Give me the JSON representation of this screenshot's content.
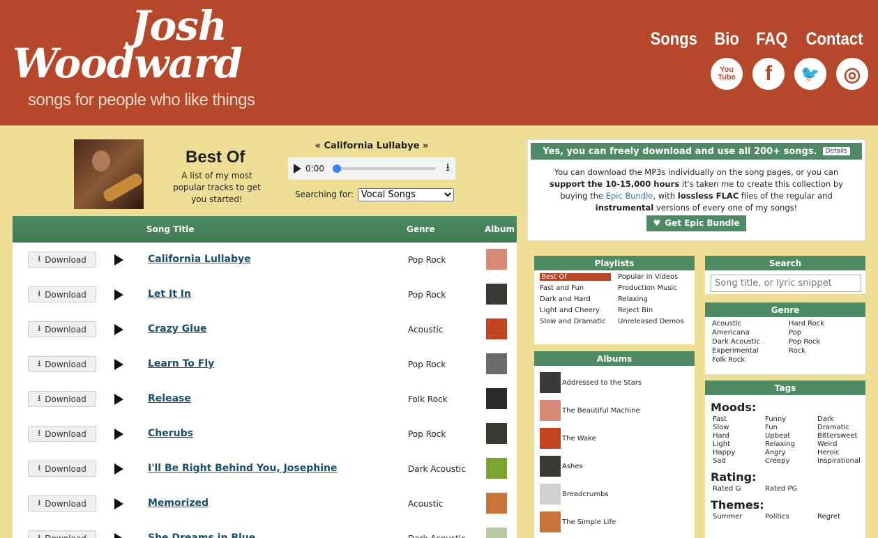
{
  "header": {
    "logo_line1": "Josh",
    "logo_line2": "Woodward",
    "tagline": "songs for people who like things",
    "nav": [
      "Songs",
      "Bio",
      "FAQ",
      "Contact"
    ],
    "social": [
      {
        "icon": "youtube-icon",
        "label": "You Tube"
      },
      {
        "icon": "facebook-icon",
        "label": "f"
      },
      {
        "icon": "twitter-icon",
        "label": "🐦"
      },
      {
        "icon": "instagram-icon",
        "label": "◎"
      }
    ]
  },
  "playlist": {
    "title": "Best Of",
    "description": "A list of my most popular tracks to get you started!"
  },
  "player": {
    "now_playing": "« California Lullabye »",
    "time": "0:00",
    "searching_label": "Searching for:",
    "searching_value": "Vocal Songs",
    "progress": 0
  },
  "table": {
    "headers": {
      "title": "Song Title",
      "genre": "Genre",
      "album": "Album"
    },
    "download_label": "Download",
    "rows": [
      {
        "title": "California Lullabye",
        "genre": "Pop Rock",
        "color": "#d88a78"
      },
      {
        "title": "Let It In",
        "genre": "Pop Rock",
        "color": "#3a3a35"
      },
      {
        "title": "Crazy Glue",
        "genre": "Acoustic",
        "color": "#c2431f"
      },
      {
        "title": "Learn To Fly",
        "genre": "Pop Rock",
        "color": "#6a6a6a"
      },
      {
        "title": "Release",
        "genre": "Folk Rock",
        "color": "#2a2a28"
      },
      {
        "title": "Cherubs",
        "genre": "Pop Rock",
        "color": "#3b3a32"
      },
      {
        "title": "I'll Be Right Behind You, Josephine",
        "genre": "Dark Acoustic",
        "color": "#7ba432"
      },
      {
        "title": "Memorized",
        "genre": "Acoustic",
        "color": "#c8733b"
      },
      {
        "title": "She Dreams in Blue",
        "genre": "Dark Acoustic",
        "color": "#b8c8a0"
      }
    ]
  },
  "banner": {
    "heading": "Yes, you can freely download and use all 200+ songs.",
    "details": "Details",
    "t1": "You can download the MP3s individually on the song pages, or you can ",
    "b1": "support the 10-15,000 hours",
    "t2": " it's taken me to create this collection by buying the ",
    "link": "Epic Bundle",
    "t3": ", with ",
    "b2": "lossless FLAC",
    "t4": " files of the regular and ",
    "b3": "instrumental",
    "t5": " versions of every one of my songs!",
    "button": "Get Epic Bundle"
  },
  "playlists": {
    "heading": "Playlists",
    "items": [
      "Best Of",
      "Popular in Videos",
      "Fast and Fun",
      "Production Music",
      "Dark and Hard",
      "Relaxing",
      "Light and Cheery",
      "Reject Bin",
      "Slow and Dramatic",
      "Unreleased Demos"
    ]
  },
  "search": {
    "heading": "Search",
    "placeholder": "Song title, or lyric snippet"
  },
  "genre": {
    "heading": "Genre",
    "items": [
      "Acoustic",
      "Hard Rock",
      "Americana",
      "Pop",
      "Dark Acoustic",
      "Pop Rock",
      "Experimental",
      "Rock",
      "Folk Rock"
    ]
  },
  "albums": {
    "heading": "Albums",
    "items": [
      {
        "name": "Addressed to the Stars",
        "color": "#3a3a38"
      },
      {
        "name": "The Beautiful Machine",
        "color": "#d88a78"
      },
      {
        "name": "The Wake",
        "color": "#c2431f"
      },
      {
        "name": "Ashes",
        "color": "#3b3a32"
      },
      {
        "name": "Breadcrumbs",
        "color": "#d0d0d0"
      },
      {
        "name": "The Simple Life",
        "color": "#c8733b"
      }
    ]
  },
  "tags": {
    "heading": "Tags",
    "moods_heading": "Moods:",
    "moods": [
      "Fast",
      "Funny",
      "Dark",
      "Slow",
      "Fun",
      "Dramatic",
      "Hard",
      "Upbeat",
      "Bittersweet",
      "Light",
      "Relaxing",
      "Weird",
      "Happy",
      "Angry",
      "Heroic",
      "Sad",
      "Creepy",
      "Inspirational"
    ],
    "rating_heading": "Rating:",
    "ratings": [
      "Rated G",
      "Rated PG"
    ],
    "themes_heading": "Themes:",
    "themes": [
      "Summer",
      "Politics",
      "Regret"
    ]
  }
}
